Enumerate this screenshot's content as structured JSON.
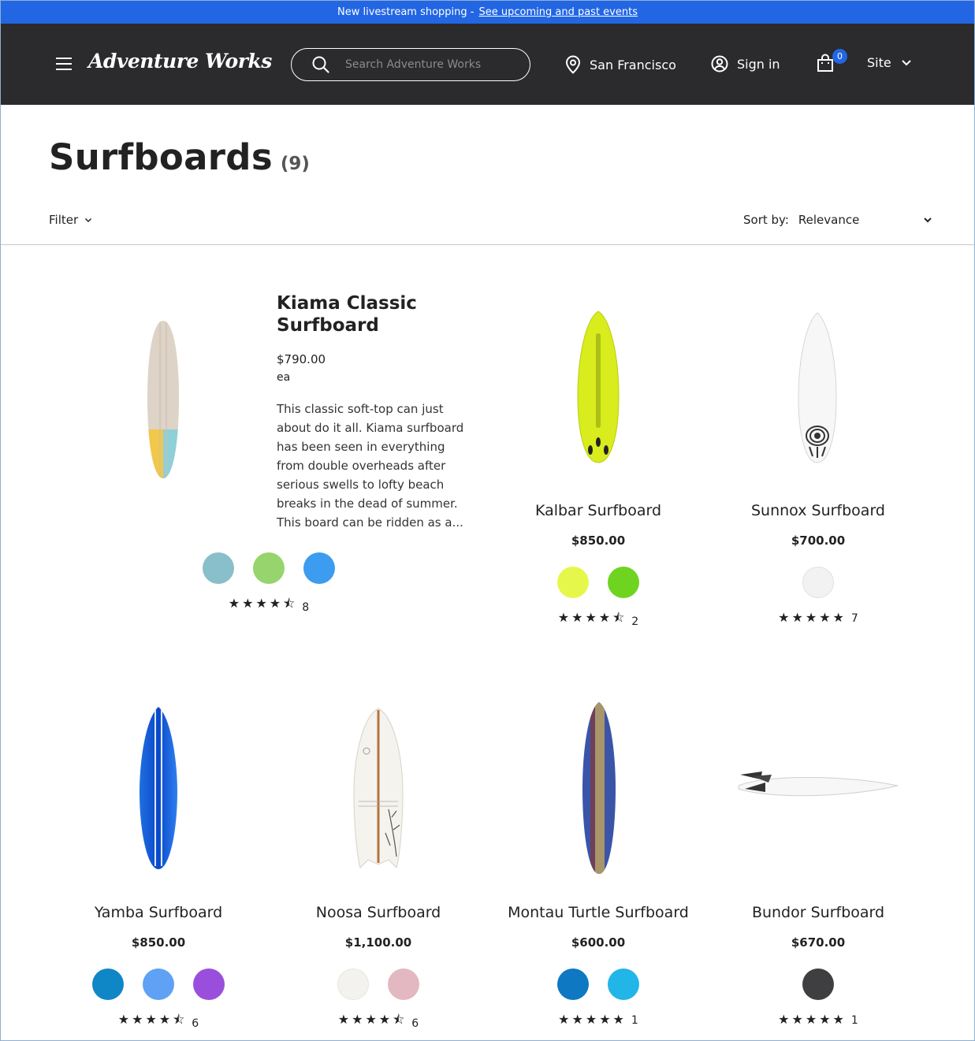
{
  "promo": {
    "text": "New livestream shopping -",
    "link": "See upcoming and past events"
  },
  "header": {
    "logo": "Adventure Works",
    "search_placeholder": "Search Adventure Works",
    "location": "San Francisco",
    "sign_in": "Sign in",
    "cart_count": "0",
    "site": "Site"
  },
  "page": {
    "title": "Surfboards",
    "count": "(9)",
    "filter_label": "Filter",
    "sort_label": "Sort by:",
    "sort_value": "Relevance"
  },
  "featured": {
    "name": "Kiama Classic Surfboard",
    "price": "$790.00",
    "unit": "ea",
    "description": "This classic soft-top can just about do it all. Kiama surfboard has been seen in everything from double overheads after serious swells to lofty beach breaks in the dead of summer. This board can be ridden as a...",
    "swatches": [
      "#88bfca",
      "#97d46e",
      "#3b9cf0"
    ],
    "stars": "★★★★⯪",
    "rating_count": "8"
  },
  "products": [
    {
      "name": "Kalbar Surfboard",
      "price": "$850.00",
      "swatches": [
        "#e6f74c",
        "#6fd420"
      ],
      "stars": "★★★★⯪",
      "rating_count": "2"
    },
    {
      "name": "Sunnox Surfboard",
      "price": "$700.00",
      "swatches": [
        "#f2f2f2"
      ],
      "stars": "★★★★★",
      "rating_count": "7"
    },
    {
      "name": "Yamba Surfboard",
      "price": "$850.00",
      "swatches": [
        "#0f86c6",
        "#5fa1f5",
        "#9a4fdc"
      ],
      "stars": "★★★★⯪",
      "rating_count": "6"
    },
    {
      "name": "Noosa Surfboard",
      "price": "$1,100.00",
      "swatches": [
        "#f3f2ef",
        "#e3b8c1"
      ],
      "stars": "★★★★⯪",
      "rating_count": "6"
    },
    {
      "name": "Montau Turtle Surfboard",
      "price": "$600.00",
      "swatches": [
        "#0f78c3",
        "#22b5e8"
      ],
      "stars": "★★★★★",
      "rating_count": "1"
    },
    {
      "name": "Bundor Surfboard",
      "price": "$670.00",
      "swatches": [
        "#3f3f41"
      ],
      "stars": "★★★★★",
      "rating_count": "1"
    }
  ]
}
